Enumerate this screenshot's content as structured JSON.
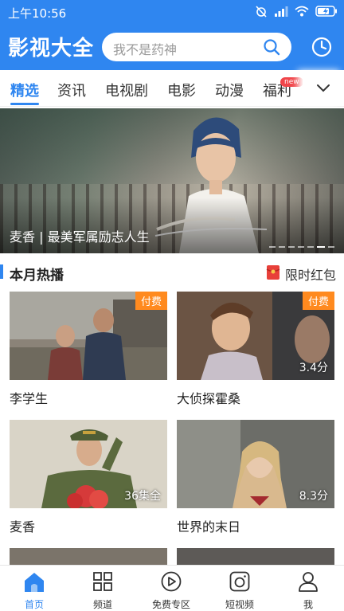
{
  "status_bar": {
    "time": "上午10:56"
  },
  "header": {
    "brand": "影视大全",
    "search_placeholder": "我不是药神"
  },
  "tabs": [
    {
      "label": "精选",
      "active": true
    },
    {
      "label": "资讯"
    },
    {
      "label": "电视剧"
    },
    {
      "label": "电影"
    },
    {
      "label": "动漫"
    },
    {
      "label": "福利",
      "badge": "new"
    }
  ],
  "banner": {
    "caption": "麦香 | 最美军属励志人生"
  },
  "section": {
    "title": "本月热播",
    "promo_label": "限时红包"
  },
  "cards": [
    {
      "title": "李学生",
      "badge": "付费",
      "meta": ""
    },
    {
      "title": "大侦探霍桑",
      "badge": "付费",
      "meta": "3.4分"
    },
    {
      "title": "麦香",
      "badge": "",
      "meta": "36集全"
    },
    {
      "title": "世界的末日",
      "badge": "",
      "meta": "8.3分"
    }
  ],
  "bottom_nav": [
    {
      "label": "首页",
      "icon": "home-icon",
      "active": true
    },
    {
      "label": "频道",
      "icon": "grid-icon"
    },
    {
      "label": "免费专区",
      "icon": "play-circle-icon"
    },
    {
      "label": "短视频",
      "icon": "camera-icon"
    },
    {
      "label": "我",
      "icon": "user-icon"
    }
  ],
  "colors": {
    "primary": "#2f86f0",
    "paid_badge": "#ff8a1f",
    "new_badge": "#f0454a"
  }
}
